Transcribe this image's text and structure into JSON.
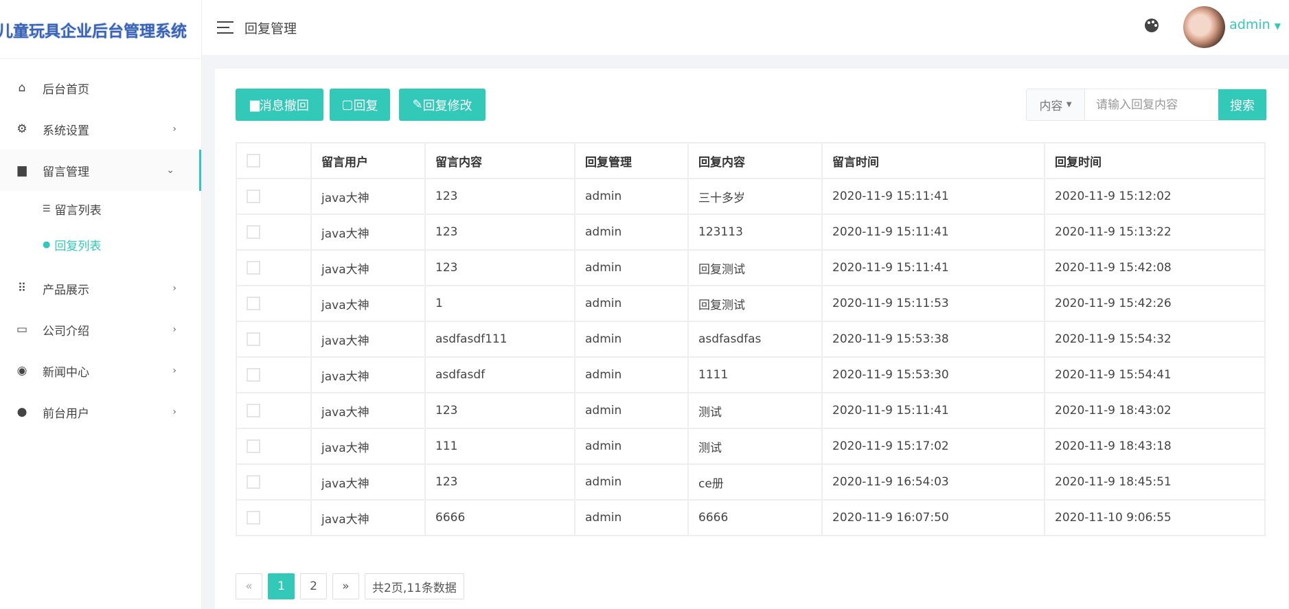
{
  "app_title": "儿童玩具企业后台管理系统",
  "sidebar": {
    "items": [
      {
        "label": "后台首页",
        "icon": "home-icon"
      },
      {
        "label": "系统设置",
        "icon": "gear-icon"
      },
      {
        "label": "留言管理",
        "icon": "comment-icon"
      },
      {
        "label": "产品展示",
        "icon": "grid-icon"
      },
      {
        "label": "公司介绍",
        "icon": "laptop-icon"
      },
      {
        "label": "新闻中心",
        "icon": "news-icon"
      },
      {
        "label": "前台用户",
        "icon": "user-icon"
      }
    ],
    "sub_items": [
      {
        "label": "留言列表"
      },
      {
        "label": "回复列表"
      }
    ]
  },
  "header": {
    "title": "回复管理",
    "user": "admin"
  },
  "toolbar": {
    "recall": "消息撤回",
    "reply": "回复",
    "edit": "回复修改",
    "search_field": "内容",
    "search_placeholder": "请输入回复内容",
    "search": "搜索"
  },
  "table": {
    "headers": [
      "留言用户",
      "留言内容",
      "回复管理",
      "回复内容",
      "留言时间",
      "回复时间"
    ],
    "rows": [
      [
        "java大神",
        "123",
        "admin",
        "三十多岁",
        "2020-11-9 15:11:41",
        "2020-11-9 15:12:02"
      ],
      [
        "java大神",
        "123",
        "admin",
        "123113",
        "2020-11-9 15:11:41",
        "2020-11-9 15:13:22"
      ],
      [
        "java大神",
        "123",
        "admin",
        "回复测试",
        "2020-11-9 15:11:41",
        "2020-11-9 15:42:08"
      ],
      [
        "java大神",
        "1",
        "admin",
        "回复测试",
        "2020-11-9 15:11:53",
        "2020-11-9 15:42:26"
      ],
      [
        "java大神",
        "asdfasdf111",
        "admin",
        "asdfasdfas",
        "2020-11-9 15:53:38",
        "2020-11-9 15:54:32"
      ],
      [
        "java大神",
        "asdfasdf",
        "admin",
        "1111",
        "2020-11-9 15:53:30",
        "2020-11-9 15:54:41"
      ],
      [
        "java大神",
        "123",
        "admin",
        "测试",
        "2020-11-9 15:11:41",
        "2020-11-9 18:43:02"
      ],
      [
        "java大神",
        "111",
        "admin",
        "测试",
        "2020-11-9 15:17:02",
        "2020-11-9 18:43:18"
      ],
      [
        "java大神",
        "123",
        "admin",
        "ce册",
        "2020-11-9 16:54:03",
        "2020-11-9 18:45:51"
      ],
      [
        "java大神",
        "6666",
        "admin",
        "6666",
        "2020-11-9 16:07:50",
        "2020-11-10 9:06:55"
      ]
    ]
  },
  "pagination": {
    "prev": "«",
    "pages": [
      "1",
      "2"
    ],
    "current": "1",
    "next": "»",
    "summary": "共2页,11条数据"
  }
}
